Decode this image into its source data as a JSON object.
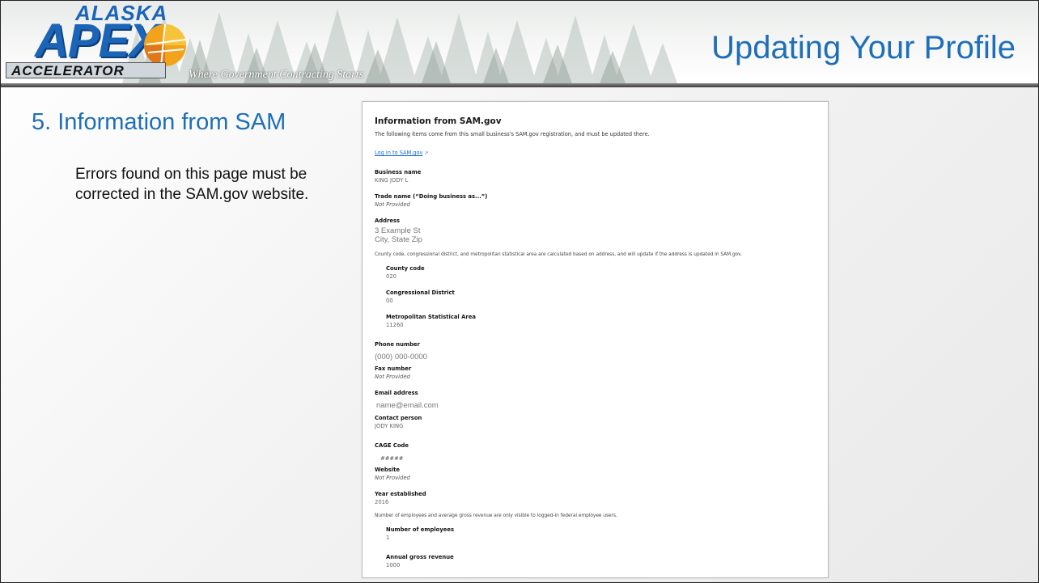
{
  "header": {
    "logo_alaska": "ALASKA",
    "logo_apex": "APEX",
    "logo_accelerator": "ACCELERATOR",
    "tagline": "Where Government Contracting Starts",
    "title": "Updating Your Profile"
  },
  "left": {
    "step_heading": "5. Information from SAM",
    "note": "Errors found on this page must be corrected in the SAM.gov website."
  },
  "sam": {
    "heading": "Information from SAM.gov",
    "intro": "The following items come from this small business's SAM.gov registration, and must be updated there.",
    "login_link": "Log in to SAM.gov",
    "business_name_label": "Business name",
    "business_name_value": "KING JODY L",
    "trade_name_label": "Trade name (“Doing business as...”)",
    "trade_name_value": "Not Provided",
    "address_label": "Address",
    "address_line1": "3 Example St",
    "address_line2": "City, State Zip",
    "address_note": "County code, congressional district, and metropolitan statistical area are calculated based on address, and will update if the address is updated in SAM.gov.",
    "county_label": "County code",
    "county_value": "020",
    "district_label": "Congressional District",
    "district_value": "00",
    "msa_label": "Metropolitan Statistical Area",
    "msa_value": "11260",
    "phone_label": "Phone number",
    "phone_value": "(000) 000-0000",
    "fax_label": "Fax number",
    "fax_value": "Not Provided",
    "email_label": "Email address",
    "email_value": "name@email.com",
    "contact_label": "Contact person",
    "contact_value": "JODY KING",
    "cage_label": "CAGE Code",
    "cage_value": "#####",
    "website_label": "Website",
    "website_value": "Not Provided",
    "year_label": "Year established",
    "year_value": "2016",
    "employee_note": "Number of employees and average gross revenue are only visible to logged-in federal employee users.",
    "employees_label": "Number of employees",
    "employees_value": "1",
    "revenue_label": "Annual gross revenue",
    "revenue_value": "1000"
  },
  "colors": {
    "title_blue": "#1e6fb8",
    "link_blue": "#1a6bc7",
    "logo_blue": "#1c64b7"
  },
  "icons": [
    "external-link-icon",
    "sun-logo-icon",
    "tree-silhouette-graphic"
  ]
}
